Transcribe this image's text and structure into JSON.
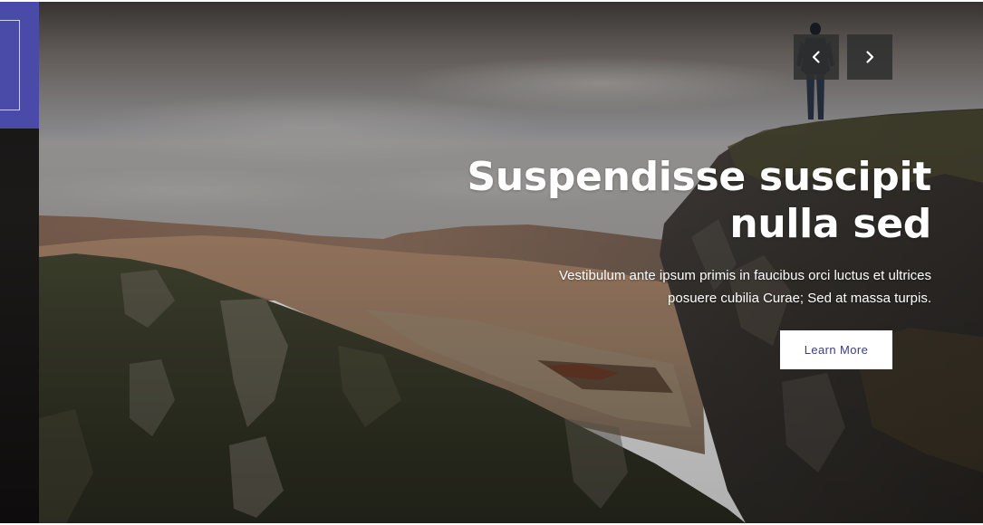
{
  "slider": {
    "title_line1": "Suspendisse suscipit",
    "title_line2": "nulla sed",
    "subtitle_line1": "Vestibulum ante ipsum primis in faucibus orci luctus et ultrices",
    "subtitle_line2": "posuere cubilia Curae; Sed at massa turpis.",
    "cta_label": "Learn More",
    "prev_icon": "chevron-left-icon",
    "next_icon": "chevron-right-icon"
  },
  "colors": {
    "accent": "#4a4aa8",
    "nav_button_bg": "#303030",
    "cta_text": "#3b3f7a",
    "cta_bg": "#ffffff",
    "caption_text": "#ffffff"
  }
}
